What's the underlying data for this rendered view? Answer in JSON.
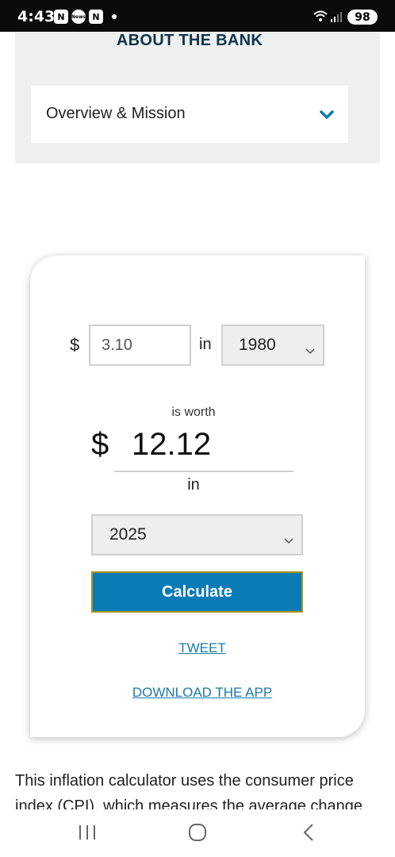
{
  "status_bar": {
    "time": "4:43",
    "notifications": [
      "N",
      "N"
    ],
    "battery": "98"
  },
  "about": {
    "title": "ABOUT THE BANK",
    "accordion_label": "Overview & Mission"
  },
  "calculator": {
    "currency_symbol": "$",
    "amount_value": "3.10",
    "in_label": "in",
    "from_year": "1980",
    "is_worth_label": "is worth",
    "result_value": "12.12",
    "target_year": "2025",
    "calculate_label": "Calculate",
    "tweet_label": "TWEET",
    "download_label": "DOWNLOAD THE APP"
  },
  "body_text": "This inflation calculator uses the consumer price index (CPI), which measures the average change",
  "colors": {
    "accent": "#0a7bb5",
    "title": "#10344a",
    "link": "#1a7aa6"
  }
}
